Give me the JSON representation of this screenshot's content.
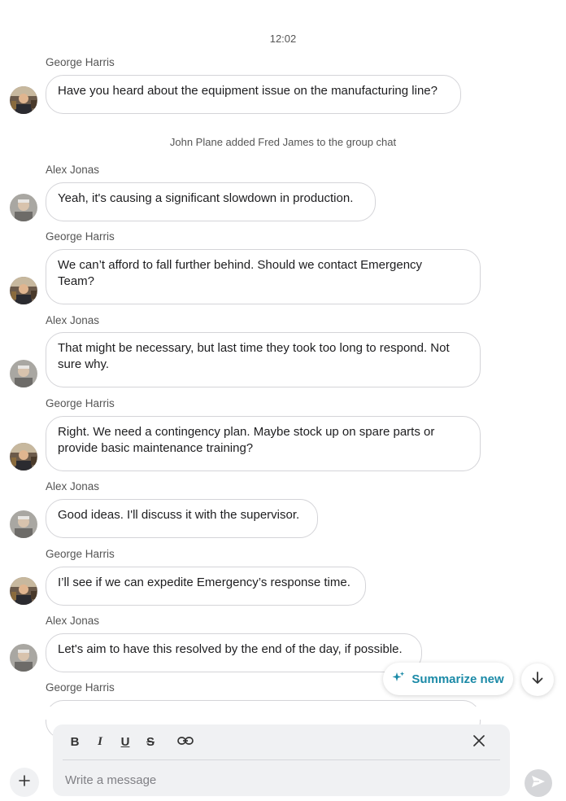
{
  "chat": {
    "timestamp": "12:02",
    "system_message": "John Plane added Fred James to the group chat",
    "messages": [
      {
        "sender": "George Harris",
        "lines": [
          "Have you heard about the equipment issue on the manufacturing line?"
        ]
      },
      {
        "sender": "Alex Jonas",
        "lines": [
          "Yeah, it's causing a significant slowdown in production."
        ]
      },
      {
        "sender": "George Harris",
        "lines": [
          "We can’t afford to fall further behind. Should we contact Emergency",
          "Team?"
        ]
      },
      {
        "sender": "Alex Jonas",
        "lines": [
          "That might be necessary, but last time they took too long to respond. Not",
          "sure why."
        ]
      },
      {
        "sender": "George Harris",
        "lines": [
          "Right. We need a contingency plan. Maybe stock up on spare parts or",
          "provide basic maintenance training?"
        ]
      },
      {
        "sender": "Alex Jonas",
        "lines": [
          "Good ideas. I'll discuss it with the supervisor."
        ]
      },
      {
        "sender": "George Harris",
        "lines": [
          "I’ll see if we can expedite Emergency’s response time."
        ]
      },
      {
        "sender": "Alex Jonas",
        "lines": [
          "Let's aim to have this resolved by the end of the day, if possible."
        ]
      },
      {
        "sender": "George Harris",
        "lines": [
          ""
        ]
      }
    ]
  },
  "summarize": {
    "label": "Summarize new",
    "icon": "sparkle-icon",
    "color": "#1b8aa7"
  },
  "scroll_down": {
    "icon": "arrow-down-icon"
  },
  "composer": {
    "toolbar": {
      "bold": "B",
      "italic": "I",
      "underline": "U",
      "strikethrough": "S"
    },
    "placeholder": "Write a message"
  },
  "colors": {
    "accent": "#1b8aa7",
    "bubble_border": "#d4d4d8",
    "composer_bg": "#f0f1f3"
  }
}
